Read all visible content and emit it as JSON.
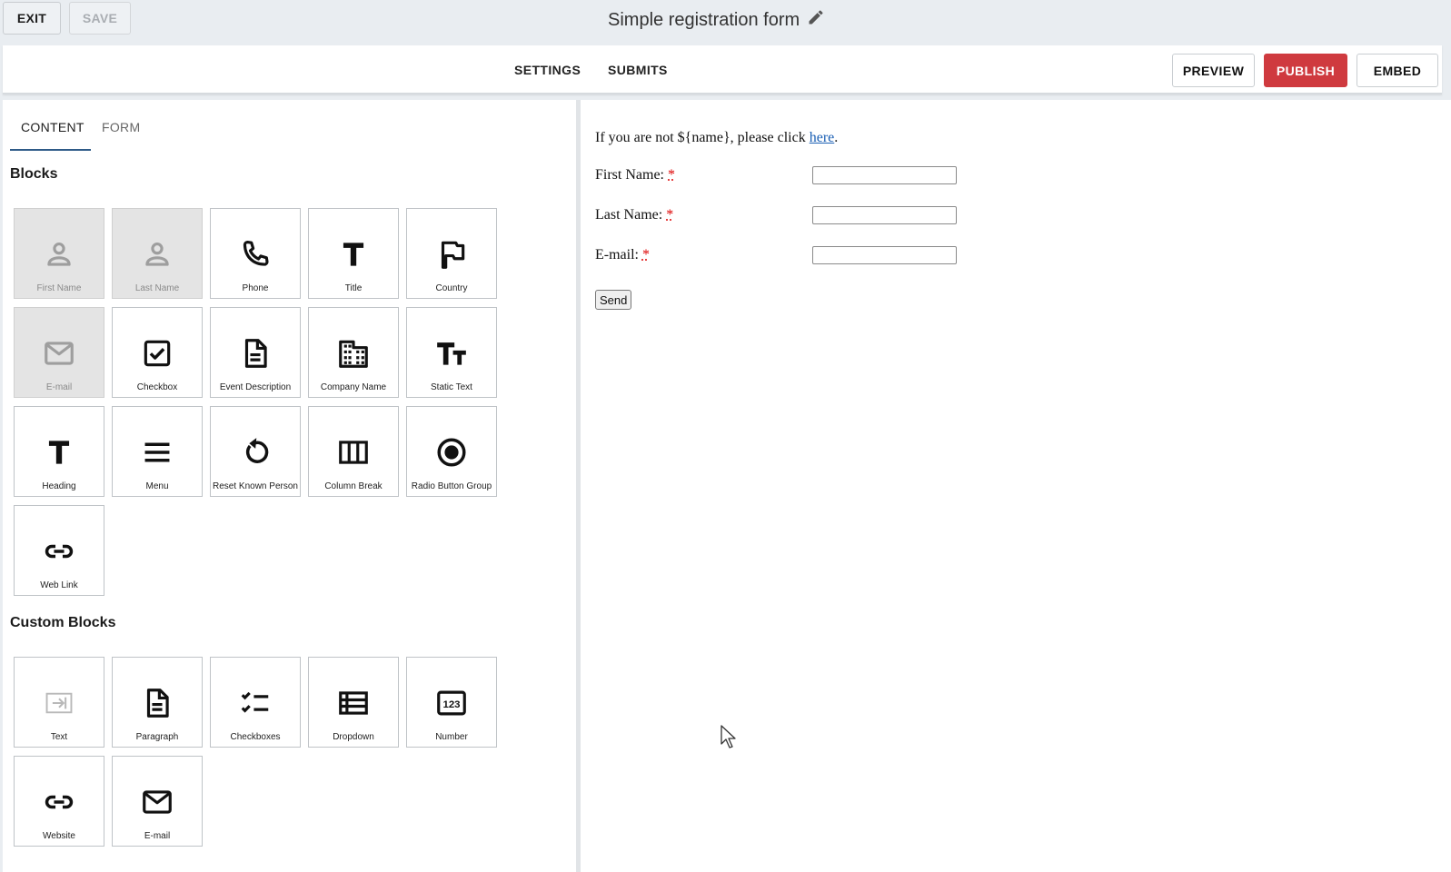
{
  "topbar": {
    "exit_label": "EXIT",
    "save_label": "SAVE",
    "form_title": "Simple registration form"
  },
  "toolbar": {
    "settings": "SETTINGS",
    "submits": "SUBMITS",
    "preview": "PREVIEW",
    "publish": "PUBLISH",
    "embed": "EMBED",
    "publish_color": "#cf3a3f"
  },
  "left": {
    "tabs": [
      {
        "label": "CONTENT",
        "active": true
      },
      {
        "label": "FORM",
        "active": false
      }
    ],
    "blocks_title": "Blocks",
    "blocks": [
      {
        "label": "First Name",
        "icon": "person-icon",
        "disabled": true
      },
      {
        "label": "Last Name",
        "icon": "person-icon",
        "disabled": true
      },
      {
        "label": "Phone",
        "icon": "phone-icon",
        "disabled": false
      },
      {
        "label": "Title",
        "icon": "title-t-icon",
        "disabled": false
      },
      {
        "label": "Country",
        "icon": "flag-icon",
        "disabled": false
      },
      {
        "label": "E-mail",
        "icon": "mail-icon",
        "disabled": true
      },
      {
        "label": "Checkbox",
        "icon": "checkbox-icon",
        "disabled": false
      },
      {
        "label": "Event Description",
        "icon": "document-icon",
        "disabled": false
      },
      {
        "label": "Company Name",
        "icon": "building-icon",
        "disabled": false
      },
      {
        "label": "Static Text",
        "icon": "text-size-icon",
        "disabled": false
      },
      {
        "label": "Heading",
        "icon": "heading-t-icon",
        "disabled": false
      },
      {
        "label": "Menu",
        "icon": "menu-icon",
        "disabled": false
      },
      {
        "label": "Reset Known Person",
        "icon": "reset-icon",
        "disabled": false
      },
      {
        "label": "Column Break",
        "icon": "column-break-icon",
        "disabled": false
      },
      {
        "label": "Radio Button Group",
        "icon": "radio-icon",
        "disabled": false
      },
      {
        "label": "Web Link",
        "icon": "link-icon",
        "disabled": false
      }
    ],
    "custom_title": "Custom Blocks",
    "custom_blocks": [
      {
        "label": "Text",
        "icon": "text-input-icon",
        "disabled": false
      },
      {
        "label": "Paragraph",
        "icon": "document-icon",
        "disabled": false
      },
      {
        "label": "Checkboxes",
        "icon": "checklist-icon",
        "disabled": false
      },
      {
        "label": "Dropdown",
        "icon": "list-icon",
        "disabled": false
      },
      {
        "label": "Number",
        "icon": "number-icon",
        "disabled": false
      },
      {
        "label": "Website",
        "icon": "link-icon",
        "disabled": false
      },
      {
        "label": "E-mail",
        "icon": "mail-icon",
        "disabled": false
      }
    ]
  },
  "preview": {
    "intro_before": "If you are not ${name}, please click ",
    "intro_link": "here",
    "intro_after": ".",
    "fields": [
      {
        "label": "First Name:",
        "required_mark": "*"
      },
      {
        "label": "Last Name:",
        "required_mark": "*"
      },
      {
        "label": "E-mail:",
        "required_mark": "*"
      }
    ],
    "send_label": "Send"
  }
}
